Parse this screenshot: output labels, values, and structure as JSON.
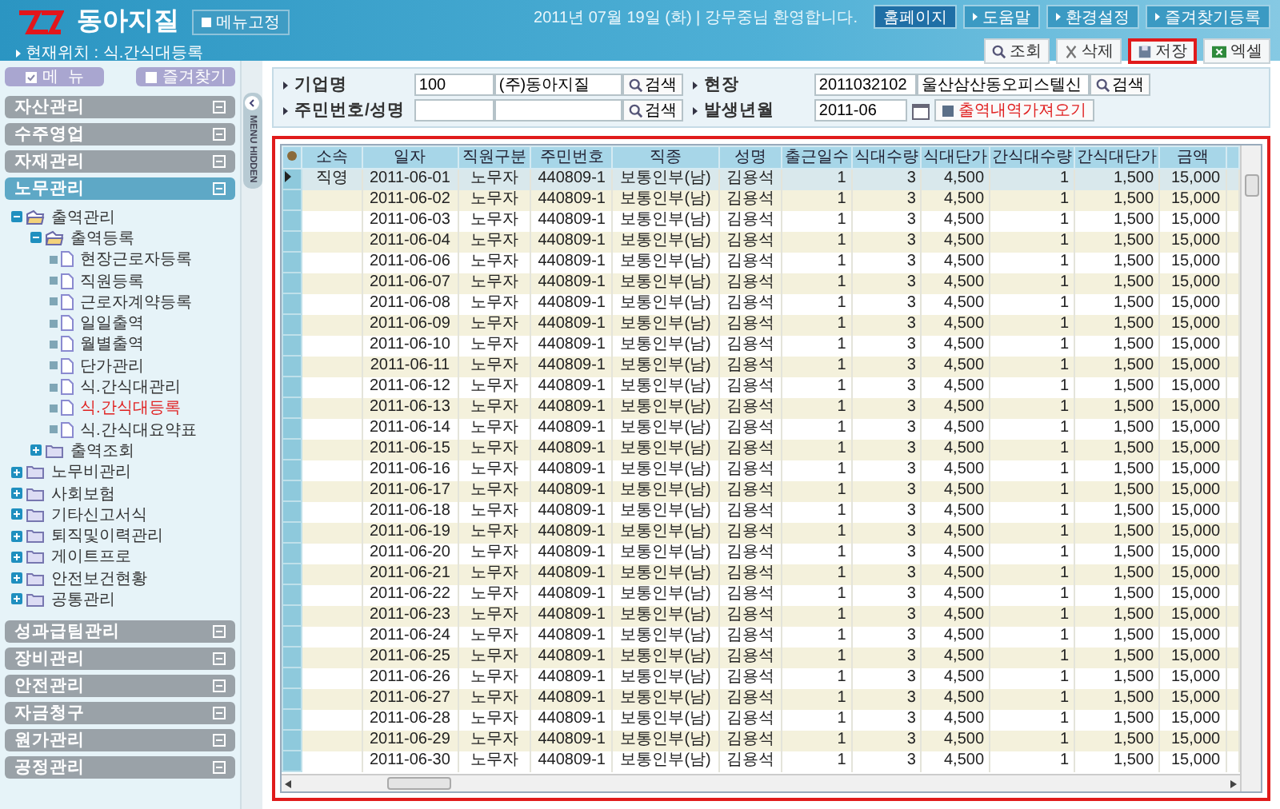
{
  "header": {
    "brand": "동아지질",
    "pin_button": "메뉴고정",
    "location": "현재위치 : 식.간식대등록",
    "greeting": "2011년 07월 19일 (화) | 강무중님 환영합니다.",
    "top_links": [
      {
        "label": "홈페이지",
        "kind": "home"
      },
      {
        "label": "도움말",
        "kind": "link"
      },
      {
        "label": "환경설정",
        "kind": "link"
      },
      {
        "label": "즐겨찾기등록",
        "kind": "link"
      }
    ]
  },
  "actions": [
    {
      "label": "조회",
      "kind": "search",
      "highlighted": false
    },
    {
      "label": "삭제",
      "kind": "delete",
      "highlighted": false
    },
    {
      "label": "저장",
      "kind": "save",
      "highlighted": true
    },
    {
      "label": "엑셀",
      "kind": "excel",
      "highlighted": false
    }
  ],
  "sidebar": {
    "menu_button": "메  뉴",
    "favorites_button": "즐겨찾기",
    "hide_tab": "MENU HIDDEN",
    "groups": [
      {
        "label": "자산관리",
        "expanded": false
      },
      {
        "label": "수주영업",
        "expanded": false
      },
      {
        "label": "자재관리",
        "expanded": false
      },
      {
        "label": "노무관리",
        "expanded": true,
        "children": [
          {
            "label": "출역관리",
            "kind": "folder",
            "expanded": true,
            "selected": false,
            "children": [
              {
                "label": "출역등록",
                "kind": "folder",
                "expanded": true,
                "selected": false,
                "children": [
                  {
                    "label": "현장근로자등록",
                    "kind": "page",
                    "selected": false
                  },
                  {
                    "label": "직원등록",
                    "kind": "page",
                    "selected": false
                  },
                  {
                    "label": "근로자계약등록",
                    "kind": "page",
                    "selected": false
                  },
                  {
                    "label": "일일출역",
                    "kind": "page",
                    "selected": false
                  },
                  {
                    "label": "월별출역",
                    "kind": "page",
                    "selected": false
                  },
                  {
                    "label": "단가관리",
                    "kind": "page",
                    "selected": false
                  },
                  {
                    "label": "식.간식대관리",
                    "kind": "page",
                    "selected": false
                  },
                  {
                    "label": "식.간식대등록",
                    "kind": "page",
                    "selected": true
                  },
                  {
                    "label": "식.간식대요약표",
                    "kind": "page",
                    "selected": false
                  }
                ]
              },
              {
                "label": "출역조회",
                "kind": "folder",
                "expanded": false,
                "selected": false
              }
            ]
          },
          {
            "label": "노무비관리",
            "kind": "folder",
            "expanded": false,
            "selected": false
          },
          {
            "label": "사회보험",
            "kind": "folder",
            "expanded": false,
            "selected": false
          },
          {
            "label": "기타신고서식",
            "kind": "folder",
            "expanded": false,
            "selected": false
          },
          {
            "label": "퇴직및이력관리",
            "kind": "folder",
            "expanded": false,
            "selected": false
          },
          {
            "label": "게이트프로",
            "kind": "folder",
            "expanded": false,
            "selected": false
          },
          {
            "label": "안전보건현황",
            "kind": "folder",
            "expanded": false,
            "selected": false
          },
          {
            "label": "공통관리",
            "kind": "folder",
            "expanded": false,
            "selected": false
          }
        ]
      },
      {
        "label": "성과급팀관리",
        "expanded": false
      },
      {
        "label": "장비관리",
        "expanded": false
      },
      {
        "label": "안전관리",
        "expanded": false
      },
      {
        "label": "자금청구",
        "expanded": false
      },
      {
        "label": "원가관리",
        "expanded": false
      },
      {
        "label": "공정관리",
        "expanded": false
      }
    ]
  },
  "filters": [
    {
      "label": "기업명",
      "values": [
        "100",
        "(주)동아지질"
      ],
      "search": "검색"
    },
    {
      "label": "현장",
      "values": [
        "2011032102",
        "울산삼산동오피스텔신"
      ],
      "search": "검색"
    },
    {
      "label": "주민번호/성명",
      "search": "검색"
    },
    {
      "label": "발생년월",
      "values": [
        "2011-06"
      ],
      "calendar": true,
      "fetch_button": "출역내역가져오기"
    }
  ],
  "table": {
    "columns": [
      "소속",
      "일자",
      "직원구분",
      "주민번호",
      "직종",
      "성명",
      "출근일수",
      "식대수량",
      "식대단가",
      "간식대수량",
      "간식대단가",
      "금액"
    ],
    "rows": [
      {
        "selected": true,
        "cells": [
          "직영",
          "2011-06-01",
          "노무자",
          "440809-1",
          "보통인부(남)",
          "김용석",
          "1",
          "3",
          "4,500",
          "1",
          "1,500",
          "15,000"
        ]
      },
      {
        "selected": false,
        "cells": [
          "",
          "2011-06-02",
          "노무자",
          "440809-1",
          "보통인부(남)",
          "김용석",
          "1",
          "3",
          "4,500",
          "1",
          "1,500",
          "15,000"
        ]
      },
      {
        "selected": false,
        "cells": [
          "",
          "2011-06-03",
          "노무자",
          "440809-1",
          "보통인부(남)",
          "김용석",
          "1",
          "3",
          "4,500",
          "1",
          "1,500",
          "15,000"
        ]
      },
      {
        "selected": false,
        "cells": [
          "",
          "2011-06-04",
          "노무자",
          "440809-1",
          "보통인부(남)",
          "김용석",
          "1",
          "3",
          "4,500",
          "1",
          "1,500",
          "15,000"
        ]
      },
      {
        "selected": false,
        "cells": [
          "",
          "2011-06-06",
          "노무자",
          "440809-1",
          "보통인부(남)",
          "김용석",
          "1",
          "3",
          "4,500",
          "1",
          "1,500",
          "15,000"
        ]
      },
      {
        "selected": false,
        "cells": [
          "",
          "2011-06-07",
          "노무자",
          "440809-1",
          "보통인부(남)",
          "김용석",
          "1",
          "3",
          "4,500",
          "1",
          "1,500",
          "15,000"
        ]
      },
      {
        "selected": false,
        "cells": [
          "",
          "2011-06-08",
          "노무자",
          "440809-1",
          "보통인부(남)",
          "김용석",
          "1",
          "3",
          "4,500",
          "1",
          "1,500",
          "15,000"
        ]
      },
      {
        "selected": false,
        "cells": [
          "",
          "2011-06-09",
          "노무자",
          "440809-1",
          "보통인부(남)",
          "김용석",
          "1",
          "3",
          "4,500",
          "1",
          "1,500",
          "15,000"
        ]
      },
      {
        "selected": false,
        "cells": [
          "",
          "2011-06-10",
          "노무자",
          "440809-1",
          "보통인부(남)",
          "김용석",
          "1",
          "3",
          "4,500",
          "1",
          "1,500",
          "15,000"
        ]
      },
      {
        "selected": false,
        "cells": [
          "",
          "2011-06-11",
          "노무자",
          "440809-1",
          "보통인부(남)",
          "김용석",
          "1",
          "3",
          "4,500",
          "1",
          "1,500",
          "15,000"
        ]
      },
      {
        "selected": false,
        "cells": [
          "",
          "2011-06-12",
          "노무자",
          "440809-1",
          "보통인부(남)",
          "김용석",
          "1",
          "3",
          "4,500",
          "1",
          "1,500",
          "15,000"
        ]
      },
      {
        "selected": false,
        "cells": [
          "",
          "2011-06-13",
          "노무자",
          "440809-1",
          "보통인부(남)",
          "김용석",
          "1",
          "3",
          "4,500",
          "1",
          "1,500",
          "15,000"
        ]
      },
      {
        "selected": false,
        "cells": [
          "",
          "2011-06-14",
          "노무자",
          "440809-1",
          "보통인부(남)",
          "김용석",
          "1",
          "3",
          "4,500",
          "1",
          "1,500",
          "15,000"
        ]
      },
      {
        "selected": false,
        "cells": [
          "",
          "2011-06-15",
          "노무자",
          "440809-1",
          "보통인부(남)",
          "김용석",
          "1",
          "3",
          "4,500",
          "1",
          "1,500",
          "15,000"
        ]
      },
      {
        "selected": false,
        "cells": [
          "",
          "2011-06-16",
          "노무자",
          "440809-1",
          "보통인부(남)",
          "김용석",
          "1",
          "3",
          "4,500",
          "1",
          "1,500",
          "15,000"
        ]
      },
      {
        "selected": false,
        "cells": [
          "",
          "2011-06-17",
          "노무자",
          "440809-1",
          "보통인부(남)",
          "김용석",
          "1",
          "3",
          "4,500",
          "1",
          "1,500",
          "15,000"
        ]
      },
      {
        "selected": false,
        "cells": [
          "",
          "2011-06-18",
          "노무자",
          "440809-1",
          "보통인부(남)",
          "김용석",
          "1",
          "3",
          "4,500",
          "1",
          "1,500",
          "15,000"
        ]
      },
      {
        "selected": false,
        "cells": [
          "",
          "2011-06-19",
          "노무자",
          "440809-1",
          "보통인부(남)",
          "김용석",
          "1",
          "3",
          "4,500",
          "1",
          "1,500",
          "15,000"
        ]
      },
      {
        "selected": false,
        "cells": [
          "",
          "2011-06-20",
          "노무자",
          "440809-1",
          "보통인부(남)",
          "김용석",
          "1",
          "3",
          "4,500",
          "1",
          "1,500",
          "15,000"
        ]
      },
      {
        "selected": false,
        "cells": [
          "",
          "2011-06-21",
          "노무자",
          "440809-1",
          "보통인부(남)",
          "김용석",
          "1",
          "3",
          "4,500",
          "1",
          "1,500",
          "15,000"
        ]
      },
      {
        "selected": false,
        "cells": [
          "",
          "2011-06-22",
          "노무자",
          "440809-1",
          "보통인부(남)",
          "김용석",
          "1",
          "3",
          "4,500",
          "1",
          "1,500",
          "15,000"
        ]
      },
      {
        "selected": false,
        "cells": [
          "",
          "2011-06-23",
          "노무자",
          "440809-1",
          "보통인부(남)",
          "김용석",
          "1",
          "3",
          "4,500",
          "1",
          "1,500",
          "15,000"
        ]
      },
      {
        "selected": false,
        "cells": [
          "",
          "2011-06-24",
          "노무자",
          "440809-1",
          "보통인부(남)",
          "김용석",
          "1",
          "3",
          "4,500",
          "1",
          "1,500",
          "15,000"
        ]
      },
      {
        "selected": false,
        "cells": [
          "",
          "2011-06-25",
          "노무자",
          "440809-1",
          "보통인부(남)",
          "김용석",
          "1",
          "3",
          "4,500",
          "1",
          "1,500",
          "15,000"
        ]
      },
      {
        "selected": false,
        "cells": [
          "",
          "2011-06-26",
          "노무자",
          "440809-1",
          "보통인부(남)",
          "김용석",
          "1",
          "3",
          "4,500",
          "1",
          "1,500",
          "15,000"
        ]
      },
      {
        "selected": false,
        "cells": [
          "",
          "2011-06-27",
          "노무자",
          "440809-1",
          "보통인부(남)",
          "김용석",
          "1",
          "3",
          "4,500",
          "1",
          "1,500",
          "15,000"
        ]
      },
      {
        "selected": false,
        "cells": [
          "",
          "2011-06-28",
          "노무자",
          "440809-1",
          "보통인부(남)",
          "김용석",
          "1",
          "3",
          "4,500",
          "1",
          "1,500",
          "15,000"
        ]
      },
      {
        "selected": false,
        "cells": [
          "",
          "2011-06-29",
          "노무자",
          "440809-1",
          "보통인부(남)",
          "김용석",
          "1",
          "3",
          "4,500",
          "1",
          "1,500",
          "15,000"
        ]
      },
      {
        "selected": false,
        "cells": [
          "",
          "2011-06-30",
          "노무자",
          "440809-1",
          "보통인부(남)",
          "김용석",
          "1",
          "3",
          "4,500",
          "1",
          "1,500",
          "15,000"
        ]
      }
    ]
  }
}
